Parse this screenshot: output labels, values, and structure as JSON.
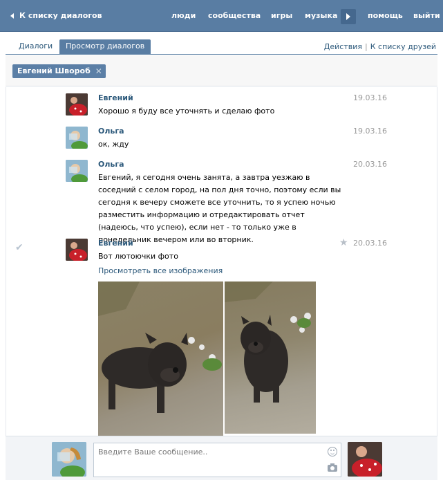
{
  "topbar": {
    "back_label": "К списку диалогов",
    "nav": [
      "люди",
      "сообщества",
      "игры",
      "музыка"
    ],
    "help": "помощь",
    "logout": "выйти"
  },
  "tabs": {
    "dialogs": "Диалоги",
    "view": "Просмотр диалогов",
    "actions": "Действия",
    "separator": "|",
    "friends": "К списку друзей"
  },
  "recipient": {
    "name": "Евгений Швороб",
    "remove": "✕"
  },
  "messages": [
    {
      "author": "Евгений",
      "date": "19.03.16",
      "text": "Хорошо я буду все уточнять и сделаю фото"
    },
    {
      "author": "Ольга",
      "date": "19.03.16",
      "text": "ок, жду"
    },
    {
      "author": "Ольга",
      "date": "20.03.16",
      "text": "Евгений, я сегодня очень занята, а завтра уезжаю в соседний с селом город, на пол дня точно, поэтому если вы сегодня к вечеру сможете все уточнить, то я успею ночью разместить информацию и отредактировать отчет (надеюсь, что успею), если нет - то только уже в понедельник вечером или во вторник."
    },
    {
      "author": "Евгений",
      "date": "20.03.16",
      "text": "Вот лютоючки фото",
      "link": "Просмотреть все изображения"
    }
  ],
  "icons": {
    "read_check": "✔",
    "star": "★"
  },
  "composer": {
    "placeholder": "Введите Ваше сообщение.."
  },
  "colors": {
    "header": "#597da3",
    "link": "#2b587a",
    "chip": "#5b7fa6"
  }
}
